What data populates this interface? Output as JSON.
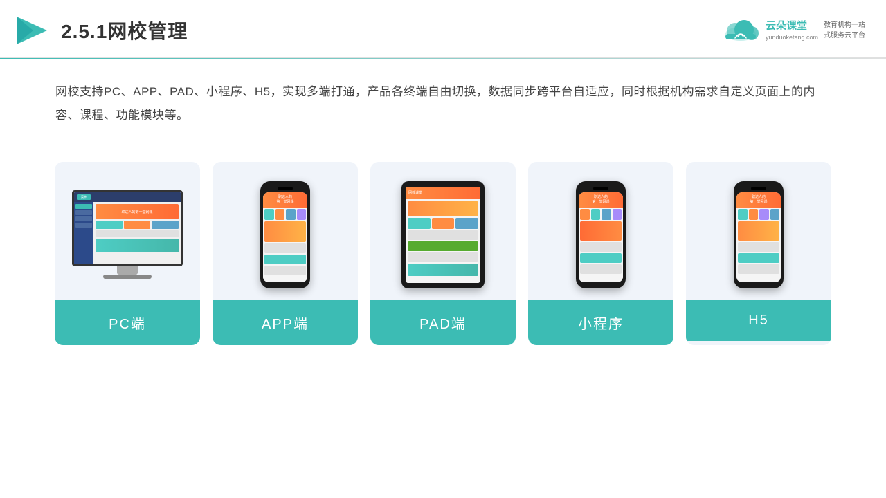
{
  "header": {
    "title": "2.5.1网校管理",
    "brand_name": "云朵课堂",
    "brand_url": "yunduoketang.com",
    "brand_tagline1": "教育机构一站",
    "brand_tagline2": "式服务云平台"
  },
  "description": "网校支持PC、APP、PAD、小程序、H5，实现多端打通，产品各终端自由切换，数据同步跨平台自适应，同时根据机构需求自定义页面上的内容、课程、功能模块等。",
  "cards": [
    {
      "id": "pc",
      "label": "PC端"
    },
    {
      "id": "app",
      "label": "APP端"
    },
    {
      "id": "pad",
      "label": "PAD端"
    },
    {
      "id": "miniapp",
      "label": "小程序"
    },
    {
      "id": "h5",
      "label": "H5"
    }
  ],
  "accent_color": "#3cbcb4"
}
